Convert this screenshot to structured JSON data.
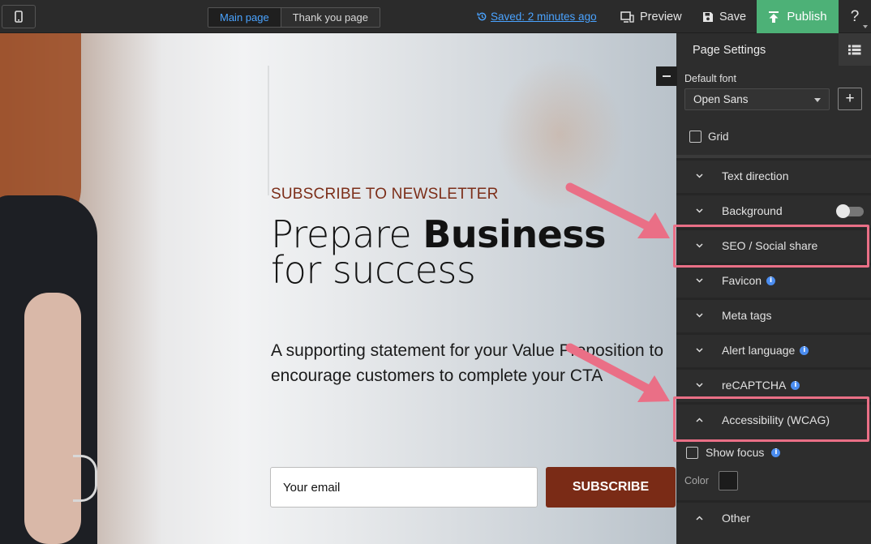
{
  "topbar": {
    "device_icon": "mobile-phone-icon",
    "tabs": [
      "Main page",
      "Thank you page"
    ],
    "saved_text": "Saved: 2 minutes ago",
    "preview_label": "Preview",
    "save_label": "Save",
    "publish_label": "Publish",
    "help_label": "?",
    "accent_color": "#4aa3ff",
    "publish_color": "#4db177"
  },
  "canvas": {
    "newsletter_label": "SUBSCRIBE TO NEWSLETTER",
    "headline_light": "Prepare ",
    "headline_bold": "Business",
    "headline_line2": "for success",
    "statement": "A supporting statement for your Value Proposition to encourage customers to complete your CTA",
    "email_placeholder": "Your email",
    "subscribe_label": "SUBSCRIBE",
    "brand_color": "#7a2b16"
  },
  "panel": {
    "title": "Page Settings",
    "default_font_label": "Default font",
    "default_font_value": "Open Sans",
    "add_font_label": "+",
    "grid_label": "Grid",
    "sections": [
      {
        "label": "Text direction",
        "expanded": false
      },
      {
        "label": "Background",
        "expanded": false
      },
      {
        "label": "SEO / Social share",
        "expanded": false
      },
      {
        "label": "Favicon",
        "expanded": false
      },
      {
        "label": "Meta tags",
        "expanded": false
      },
      {
        "label": "Alert language",
        "expanded": false
      },
      {
        "label": "reCAPTCHA",
        "expanded": false
      },
      {
        "label": "Accessibility (WCAG)",
        "expanded": true
      },
      {
        "label": "Other",
        "expanded": true
      }
    ],
    "show_focus_label": "Show focus",
    "color_label": "Color",
    "focus_color": "#1c1c1c",
    "highlight_color": "#ea6f86"
  }
}
